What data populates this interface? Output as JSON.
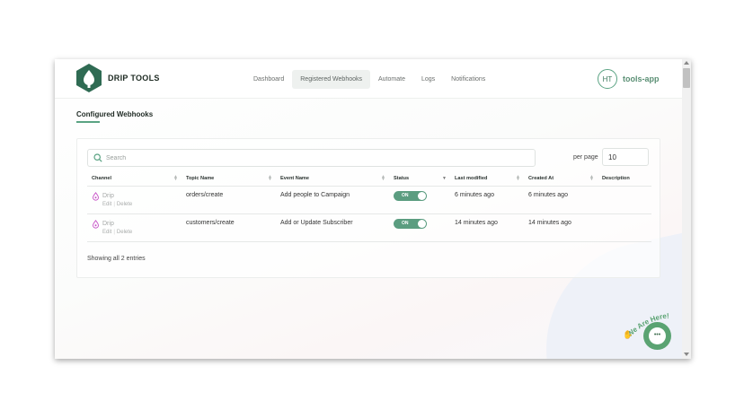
{
  "brand": {
    "name": "DRIP TOOLS",
    "accent": "#5aa383",
    "logo_color": "#2f6b53"
  },
  "nav": {
    "items": [
      {
        "label": "Dashboard"
      },
      {
        "label": "Registered Webhooks",
        "active": true
      },
      {
        "label": "Automate"
      },
      {
        "label": "Logs"
      },
      {
        "label": "Notifications"
      }
    ]
  },
  "user": {
    "initials": "HT",
    "app_name": "tools-app"
  },
  "page": {
    "title": "Configured Webhooks"
  },
  "search": {
    "placeholder": "Search"
  },
  "pagination": {
    "per_page_label": "per page",
    "per_page_value": "10"
  },
  "table": {
    "columns": [
      "Channel",
      "Topic Name",
      "Event Name",
      "Status",
      "Last modified",
      "Created At",
      "Description"
    ],
    "rows": [
      {
        "channel": "Drip",
        "edit": "Edit",
        "delete": "Delete",
        "topic": "orders/create",
        "event": "Add people to Campaign",
        "status": "ON",
        "last_modified": "6 minutes ago",
        "created_at": "6 minutes ago",
        "description": ""
      },
      {
        "channel": "Drip",
        "edit": "Edit",
        "delete": "Delete",
        "topic": "customers/create",
        "event": "Add or Update Subscriber",
        "status": "ON",
        "last_modified": "14 minutes ago",
        "created_at": "14 minutes ago",
        "description": ""
      }
    ]
  },
  "footer": {
    "entries": "Showing all 2 entries"
  },
  "chat": {
    "tagline": "We Are Here!",
    "icon": "chat-icon"
  }
}
